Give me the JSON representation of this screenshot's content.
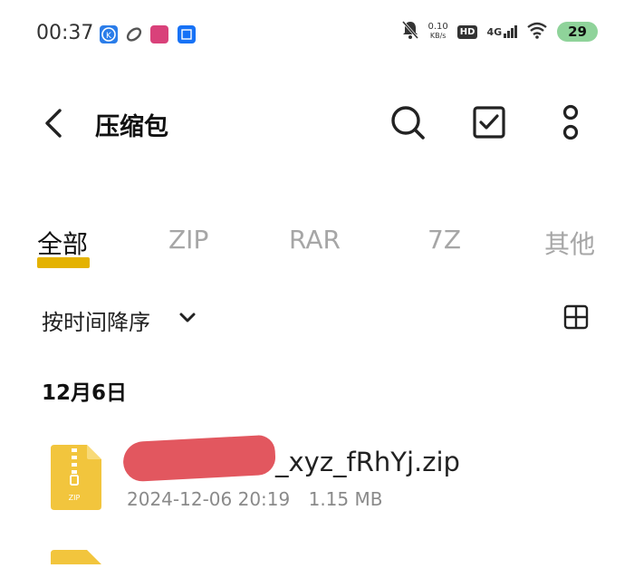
{
  "status_bar": {
    "time": "00:37",
    "net_speed_top": "0.10",
    "net_speed_bottom": "KB/s",
    "hd": "HD",
    "network": "4G",
    "battery": "29",
    "app_icons": [
      "k-app-icon",
      "link-app-icon",
      "weibo-app-icon",
      "zhihu-app-icon"
    ]
  },
  "app_bar": {
    "title": "压缩包"
  },
  "tabs": [
    {
      "label": "全部",
      "active": true
    },
    {
      "label": "ZIP",
      "active": false
    },
    {
      "label": "RAR",
      "active": false
    },
    {
      "label": "7Z",
      "active": false
    },
    {
      "label": "其他",
      "active": false
    }
  ],
  "sort": {
    "label": "按时间降序"
  },
  "groups": [
    {
      "date": "12月6日",
      "files": [
        {
          "name_visible": "_xyz_fRhYj.zip",
          "date": "2024-12-06 20:19",
          "size": "1.15 MB",
          "icon_text": "ZIP"
        }
      ]
    }
  ],
  "colors": {
    "accent": "#e4b200",
    "zip_icon": "#f2c53d",
    "battery": "#8fd39a",
    "redaction": "#e2575f"
  }
}
